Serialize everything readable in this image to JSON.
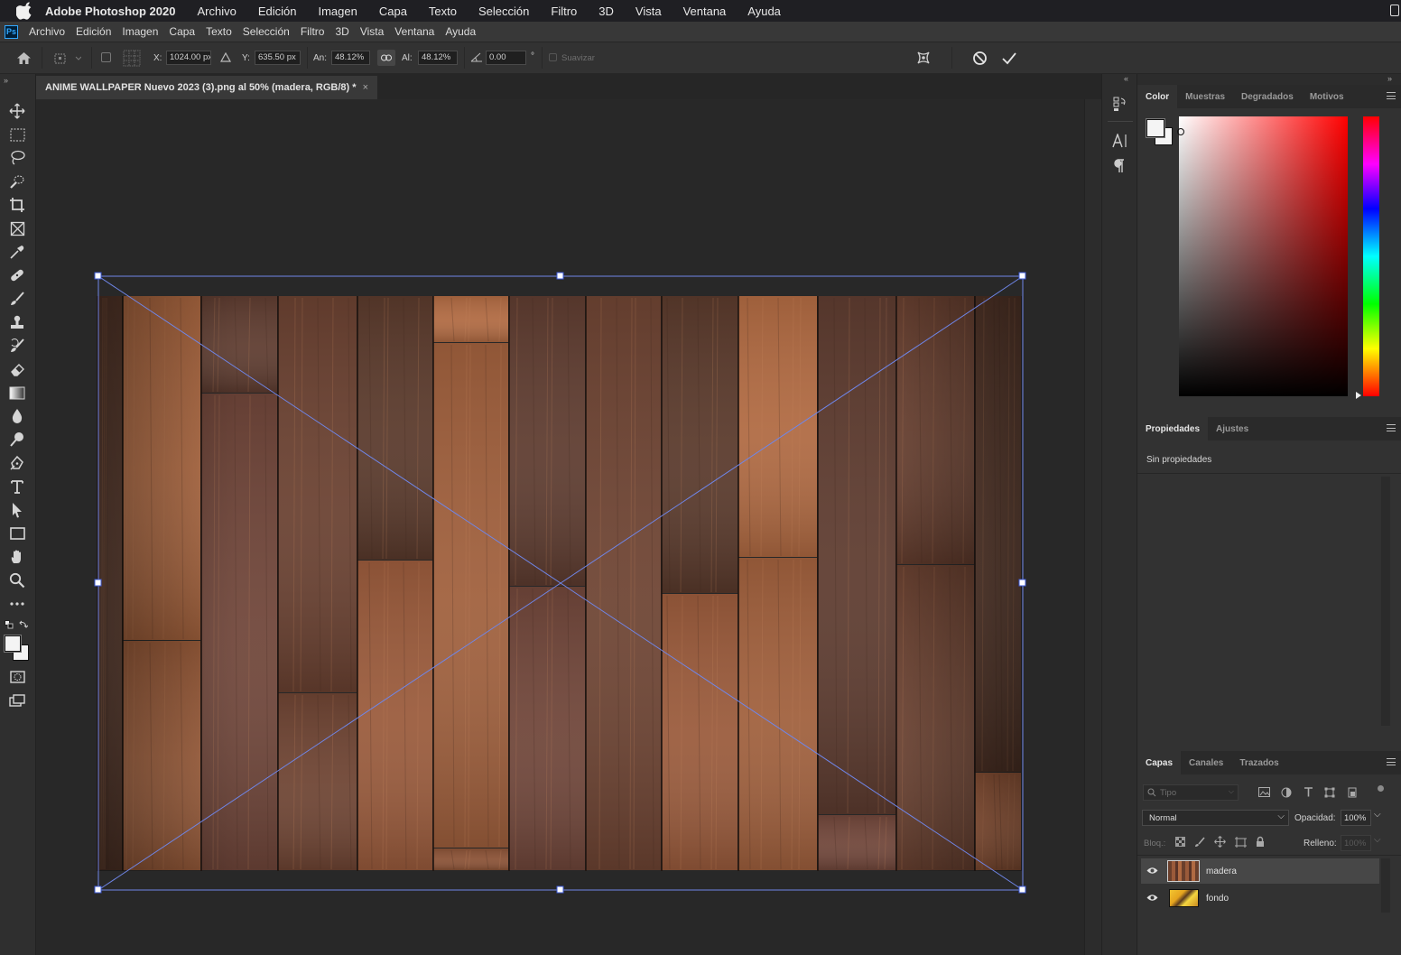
{
  "mac_menu": {
    "app_name": "Adobe Photoshop 2020",
    "items": [
      "Archivo",
      "Edición",
      "Imagen",
      "Capa",
      "Texto",
      "Selección",
      "Filtro",
      "3D",
      "Vista",
      "Ventana",
      "Ayuda"
    ]
  },
  "ps_menu": {
    "logo": "Ps",
    "items": [
      "Archivo",
      "Edición",
      "Imagen",
      "Capa",
      "Texto",
      "Selección",
      "Filtro",
      "3D",
      "Vista",
      "Ventana",
      "Ayuda"
    ]
  },
  "options_bar": {
    "x_label": "X:",
    "x_value": "1024.00 px",
    "y_label": "Y:",
    "y_value": "635.50 px",
    "w_label": "An:",
    "w_value": "48.12%",
    "h_label": "Al:",
    "h_value": "48.12%",
    "angle_value": "0.00",
    "degree_symbol": "°",
    "smooth_label": "Suavizar"
  },
  "document": {
    "tab_title": "ANIME WALLPAPER Nuevo 2023 (3).png al 50% (madera, RGB/8) *",
    "close_glyph": "×"
  },
  "color_panel": {
    "tabs": [
      "Color",
      "Muestras",
      "Degradados",
      "Motivos"
    ],
    "active_tab": "Color",
    "hue_color": "#ff0000"
  },
  "properties_panel": {
    "tabs": [
      "Propiedades",
      "Ajustes"
    ],
    "active_tab": "Propiedades",
    "content": "Sin propiedades"
  },
  "layers_panel": {
    "tabs": [
      "Capas",
      "Canales",
      "Trazados"
    ],
    "active_tab": "Capas",
    "filter_placeholder": "Tipo",
    "blend_mode": "Normal",
    "opacity_label": "Opacidad:",
    "opacity_value": "100%",
    "lock_label": "Bloq.:",
    "fill_label": "Relleno:",
    "fill_value": "100%",
    "layers": [
      {
        "name": "madera",
        "selected": true,
        "visible": true
      },
      {
        "name": "fondo",
        "selected": false,
        "visible": true
      }
    ]
  },
  "colors": {
    "wood_dark": "#5a3a2c",
    "wood_mid": "#8a5236",
    "wood_light": "#b06a42",
    "transform_line": "#6b8cff"
  }
}
